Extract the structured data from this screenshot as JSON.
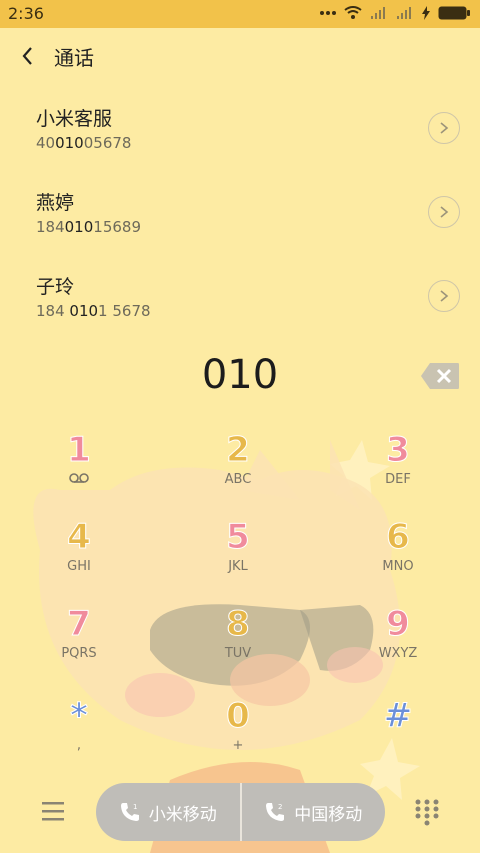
{
  "status_bar": {
    "time": "2:36"
  },
  "header": {
    "title": "通话"
  },
  "contacts": [
    {
      "name": "小米客服",
      "num_pre": "40",
      "num_match": "010",
      "num_post": "05678"
    },
    {
      "name": "燕婷",
      "num_pre": "184",
      "num_match": "010",
      "num_post": "15689"
    },
    {
      "name": "子玲",
      "num_pre": "184 ",
      "num_match": "010",
      "num_post": "1 5678"
    }
  ],
  "dial": {
    "typed": "010"
  },
  "keypad": [
    {
      "digit": "1",
      "letters": ""
    },
    {
      "digit": "2",
      "letters": "ABC"
    },
    {
      "digit": "3",
      "letters": "DEF"
    },
    {
      "digit": "4",
      "letters": "GHI"
    },
    {
      "digit": "5",
      "letters": "JKL"
    },
    {
      "digit": "6",
      "letters": "MNO"
    },
    {
      "digit": "7",
      "letters": "PQRS"
    },
    {
      "digit": "8",
      "letters": "TUV"
    },
    {
      "digit": "9",
      "letters": "WXYZ"
    },
    {
      "digit": "*",
      "letters": ","
    },
    {
      "digit": "0",
      "letters": "+"
    },
    {
      "digit": "#",
      "letters": ""
    }
  ],
  "call_buttons": {
    "sim1_label": "小米移动",
    "sim2_label": "中国移动"
  },
  "colors": {
    "background": "#FDEBA3",
    "status_bar": "#F2C24A",
    "pink": "#F08B9C",
    "gold": "#E7B84A",
    "blue": "#6B8FD8"
  },
  "icons": [
    "wifi-icon",
    "signal-icon",
    "charging-icon",
    "battery-icon",
    "back-arrow-icon",
    "chevron-right-icon",
    "backspace-icon",
    "voicemail-icon",
    "menu-icon",
    "phone-sim1-icon",
    "phone-sim2-icon",
    "dialpad-icon"
  ]
}
